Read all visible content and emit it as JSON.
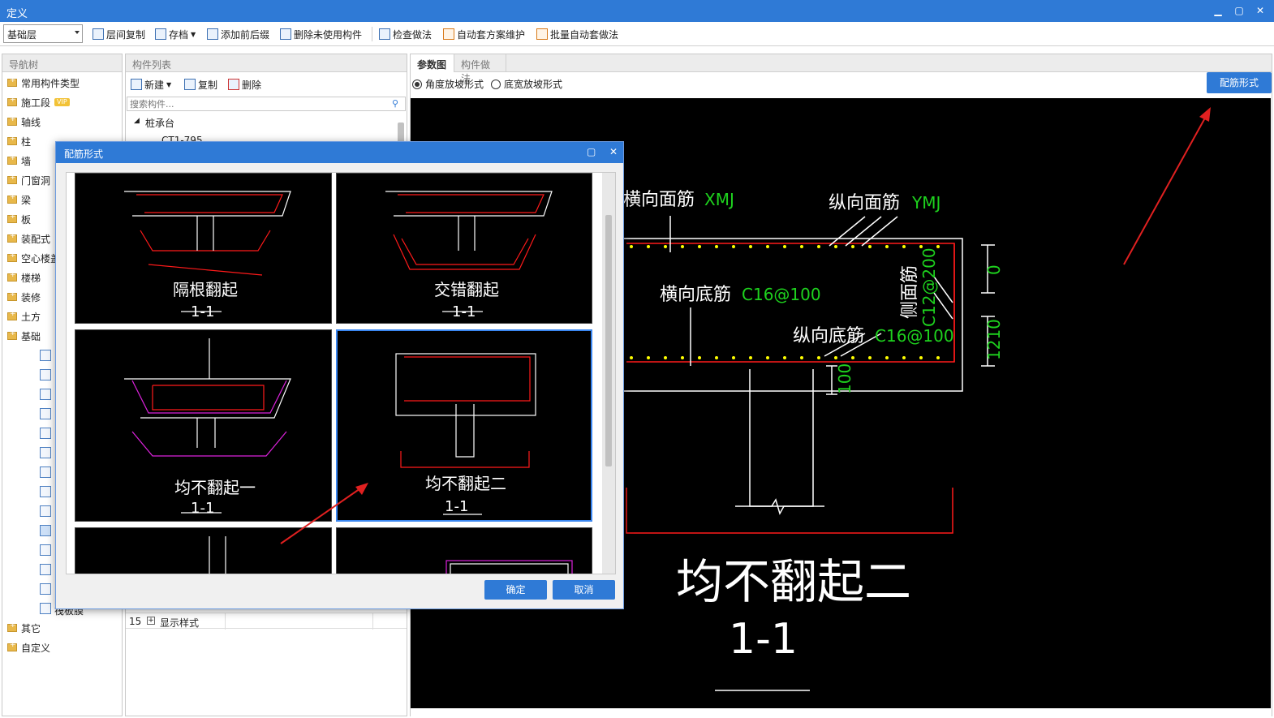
{
  "window": {
    "title": "定义"
  },
  "toolbar": {
    "floor_select": "基础层",
    "items": [
      "层间复制",
      "存档",
      "添加前后缀",
      "删除未使用构件",
      "检查做法",
      "自动套方案维护",
      "批量自动套做法"
    ]
  },
  "nav": {
    "header": "导航树",
    "items": [
      "常用构件类型",
      "施工段",
      "轴线",
      "柱",
      "墙",
      "门窗洞",
      "梁",
      "板",
      "装配式",
      "空心楼盖",
      "楼梯",
      "装修",
      "土方",
      "基础"
    ],
    "vip_badge": "VIP",
    "bottom_items": [
      "其它",
      "自定义"
    ],
    "partial_child": "筏板膜"
  },
  "component_list": {
    "header": "构件列表",
    "new_label": "新建",
    "copy_label": "复制",
    "delete_label": "删除",
    "search_placeholder": "搜索构件...",
    "tree_root": "桩承台",
    "tree_child": "CT1-795",
    "row_number": "15",
    "row_label": "显示样式"
  },
  "param_panel": {
    "tabs": [
      "参数图",
      "构件做法"
    ],
    "radio_angle": "角度放坡形式",
    "radio_width": "底宽放坡形式",
    "button_rebar_form": "配筋形式"
  },
  "canvas": {
    "labels": {
      "xmj": "横向面筋",
      "xmj_code": "XMJ",
      "ymj": "纵向面筋",
      "ymj_code": "YMJ",
      "bottom_x": "横向底筋",
      "bottom_x_code": "C16@100",
      "bottom_y": "纵向底筋",
      "bottom_y_code": "C16@100",
      "side": "侧面筋",
      "side_code": "C12@200",
      "dim_0": "0",
      "dim_1210": "1210",
      "dim_100": "100",
      "title": "均不翻起二",
      "section": "1-1"
    }
  },
  "dialog": {
    "title": "配筋形式",
    "options": [
      {
        "name": "隔根翻起",
        "section": "1-1"
      },
      {
        "name": "交错翻起",
        "section": "1-1"
      },
      {
        "name": "均不翻起一",
        "section": "1-1"
      },
      {
        "name": "均不翻起二",
        "section": "1-1"
      }
    ],
    "selected": "均不翻起二",
    "ok": "确定",
    "cancel": "取消"
  },
  "colors": {
    "accent": "#2f7ad6",
    "cad_red": "#ff1a1a",
    "cad_green": "#1ed21e",
    "cad_yellow": "#ffff00",
    "annotation_arrow": "#e02020"
  }
}
